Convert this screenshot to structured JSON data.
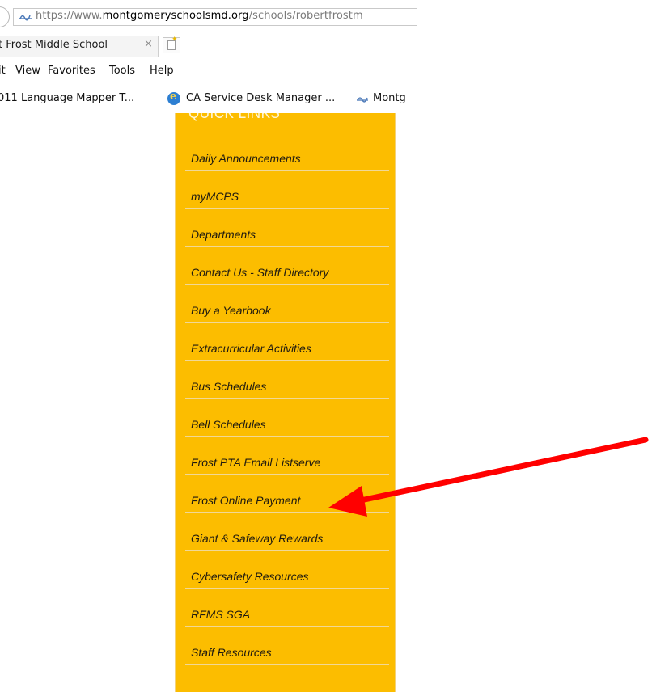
{
  "browser": {
    "url_scheme": "https://www.",
    "url_host": "montgomeryschoolsmd.org",
    "url_path": "/schools/robertfrostm",
    "tab_title": "t Frost Middle School",
    "tab_close": "×",
    "nav_glyph": "❯",
    "menu": [
      "it",
      "View",
      "Favorites",
      "Tools",
      "Help"
    ],
    "favorites": [
      {
        "label": "011 Language Mapper T..."
      },
      {
        "label": "CA Service Desk Manager ..."
      },
      {
        "label": "Montg"
      }
    ],
    "icons": {
      "site": "montgomery-schools-icon",
      "ie": "internet-explorer-icon",
      "new_tab": "new-tab-icon"
    }
  },
  "quick_links": {
    "title": "QUICK LINKS",
    "items": [
      "Daily Announcements",
      "myMCPS",
      "Departments",
      "Contact Us - Staff Directory",
      "Buy a Yearbook",
      "Extracurricular Activities",
      "Bus Schedules",
      "Bell Schedules",
      "Frost PTA Email Listserve",
      "Frost Online Payment",
      "Giant & Safeway Rewards",
      "Cybersafety Resources",
      "RFMS SGA",
      "Staff Resources"
    ]
  },
  "colors": {
    "panel_bg": "#fcbd00",
    "arrow": "#ff0000",
    "title_text": "#fff6d8"
  },
  "annotation": {
    "points_to": "Frost Online Payment"
  }
}
